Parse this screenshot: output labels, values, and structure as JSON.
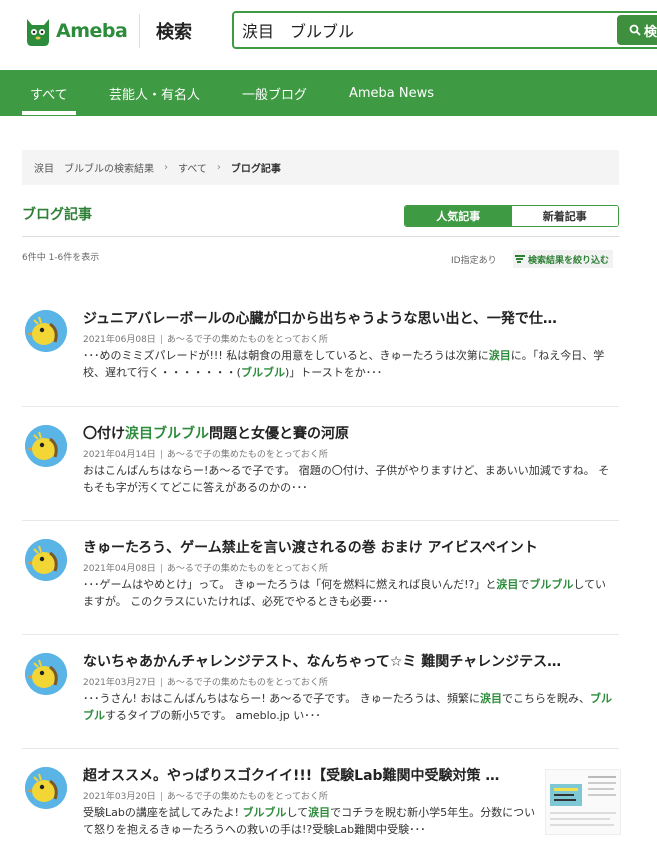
{
  "header": {
    "logo_text": "Ameba",
    "title": "検索",
    "search_value": "涙目　ブルブル",
    "search_button_label": "検"
  },
  "nav": {
    "tabs": [
      {
        "label": "すべて",
        "active": true
      },
      {
        "label": "芸能人・有名人",
        "active": false
      },
      {
        "label": "一般ブログ",
        "active": false
      },
      {
        "label": "Ameba News",
        "active": false
      }
    ]
  },
  "breadcrumb": {
    "items": [
      "涙目　ブルブルの検索結果",
      "すべて",
      "ブログ記事"
    ]
  },
  "section": {
    "title": "ブログ記事",
    "sort_popular": "人気記事",
    "sort_new": "新着記事",
    "result_count": "6件中 1-6件を表示",
    "id_filter": "ID指定あり",
    "narrow_label": "検索結果を絞り込む"
  },
  "results": [
    {
      "title": "ジュニアバレーボールの心臓が口から出ちゃうような思い出と、一発で仕…",
      "date": "2021年06月08日",
      "blog": "あ～るで子の集めたものをとっておく所",
      "snippet": [
        {
          "t": "･･･めのミミズパレードが!!! 私は朝食の用意をしていると、きゅーたろうは次第に"
        },
        {
          "t": "涙目",
          "h": true
        },
        {
          "t": "に。「ねえ今日、学校、遅れて行く・・・・・・・("
        },
        {
          "t": "ブルブル",
          "h": true
        },
        {
          "t": ")」トーストをか･･･"
        }
      ]
    },
    {
      "title_parts": [
        {
          "t": "〇付け"
        },
        {
          "t": "涙目ブルブル",
          "h": true
        },
        {
          "t": "問題と女優と賽の河原"
        }
      ],
      "date": "2021年04月14日",
      "blog": "あ～るで子の集めたものをとっておく所",
      "snippet": [
        {
          "t": "おはこんばんちはならー!あ～るで子です。 宿題の〇付け、子供がやりますけど、まあいい加減ですね。 そもそも字が汚くてどこに答えがあるのかの･･･"
        }
      ]
    },
    {
      "title": "きゅーたろう、ゲーム禁止を言い渡されるの巻 おまけ アイビスペイント",
      "date": "2021年04月08日",
      "blog": "あ～るで子の集めたものをとっておく所",
      "snippet": [
        {
          "t": "･･･ゲームはやめとけ」って。 きゅーたろうは「何を燃料に燃えれば良いんだ!?」と"
        },
        {
          "t": "涙目",
          "h": true
        },
        {
          "t": "で"
        },
        {
          "t": "ブルブル",
          "h": true
        },
        {
          "t": "していますが。 このクラスにいたければ、必死でやるときも必要･･･"
        }
      ]
    },
    {
      "title": "ないちゃあかんチャレンジテスト、なんちゃって☆ミ 難関チャレンジテス…",
      "date": "2021年03月27日",
      "blog": "あ～るで子の集めたものをとっておく所",
      "snippet": [
        {
          "t": "･･･うさん! おはこんばんちはならー! あ～るで子です。 きゅーたろうは、頻繁に"
        },
        {
          "t": "涙目",
          "h": true
        },
        {
          "t": "でこちらを睨み、"
        },
        {
          "t": "ブルブル",
          "h": true
        },
        {
          "t": "するタイプの新小5です。 ameblo.jp い･･･"
        }
      ]
    },
    {
      "title": "超オススメ。やっぱりスゴクイイ!!!【受験Lab難関中受験対策 …",
      "date": "2021年03月20日",
      "blog": "あ～るで子の集めたものをとっておく所",
      "snippet": [
        {
          "t": "受験Labの講座を試してみたよ! "
        },
        {
          "t": "ブルブル",
          "h": true
        },
        {
          "t": "して"
        },
        {
          "t": "涙目",
          "h": true
        },
        {
          "t": "でコチラを睨む新小学5年生。分数について怒りを抱えるきゅーたろうへの救いの手は!?受験Lab難関中受験･･･"
        }
      ]
    }
  ],
  "colors": {
    "brand_green": "#3e9a43",
    "highlight_green": "#2d8c3c"
  }
}
